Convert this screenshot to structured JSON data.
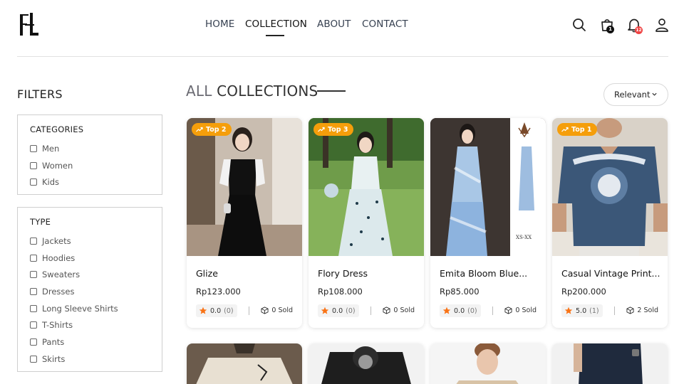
{
  "brand": {
    "logo_icon": "fi-monogram-logo"
  },
  "nav": {
    "items": [
      {
        "label": "HOME"
      },
      {
        "label": "COLLECTION",
        "active": true
      },
      {
        "label": "ABOUT"
      },
      {
        "label": "CONTACT"
      }
    ]
  },
  "header_icons": {
    "search": "search-icon",
    "cart": "shopping-bag-icon",
    "cart_count": "1",
    "notifications": "bell-icon",
    "notification_count": "12",
    "profile": "user-icon"
  },
  "filters": {
    "title": "FILTERS",
    "categories": {
      "heading": "CATEGORIES",
      "options": [
        "Men",
        "Women",
        "Kids"
      ]
    },
    "type": {
      "heading": "TYPE",
      "options": [
        "Jackets",
        "Hoodies",
        "Sweaters",
        "Dresses",
        "Long Sleeve Shirts",
        "T-Shirts",
        "Pants",
        "Skirts"
      ]
    }
  },
  "collection": {
    "title_part1": "ALL",
    "title_part2": "COLLECTIONS",
    "sort_value": "Relevant"
  },
  "products": [
    {
      "badge": "Top 2",
      "name": "Glize",
      "price": "Rp123.000",
      "rating": "0.0",
      "rating_count": "(0)",
      "sold": "0 Sold"
    },
    {
      "badge": "Top 3",
      "name": "Flory Dress",
      "price": "Rp108.000",
      "rating": "0.0",
      "rating_count": "(0)",
      "sold": "0 Sold"
    },
    {
      "badge": "",
      "name": "Emita Bloom Blue...",
      "price": "Rp85.000",
      "rating": "0.0",
      "rating_count": "(0)",
      "sold": "0 Sold"
    },
    {
      "badge": "Top 1",
      "name": "Casual Vintage Print...",
      "price": "Rp200.000",
      "rating": "5.0",
      "rating_count": "(1)",
      "sold": "2 Sold"
    }
  ],
  "colors": {
    "accent": "#f59e0b",
    "badge_red": "#ef4444",
    "badge_dark": "#111111"
  }
}
